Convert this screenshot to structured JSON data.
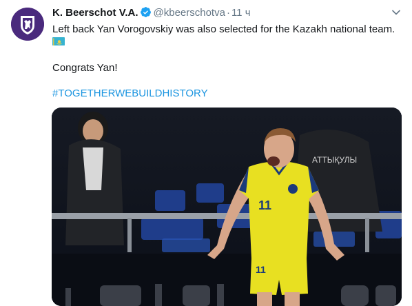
{
  "tweet": {
    "display_name": "K. Beerschot V.A.",
    "handle": "@kbeerschotva",
    "separator": "·",
    "time": "11 ч",
    "text_line1": "Left back Yan Vorogovskiy was also selected for the Kazakh national team.",
    "text_line2": "Congrats Yan!",
    "hashtag": "#TOGETHERWEBUILDHISTORY",
    "photo": {
      "jersey_number": "11",
      "banner_text": "ATTЫҚУЛЫ"
    }
  },
  "icons": {
    "avatar": "club-crest-icon",
    "verified": "verified-badge-icon",
    "menu": "chevron-down-icon",
    "flag": "kazakhstan-flag-icon"
  },
  "colors": {
    "link": "#1b95e0",
    "secondary_text": "#657786",
    "avatar_bg": "#4a2a7d",
    "jersey": "#e8e021"
  }
}
